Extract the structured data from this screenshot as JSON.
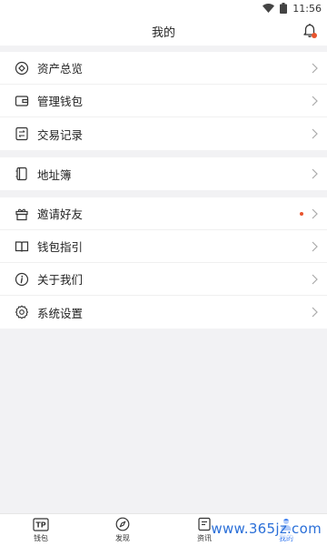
{
  "status_bar": {
    "time": "11:56"
  },
  "header": {
    "title": "我的"
  },
  "sections": [
    {
      "items": [
        {
          "label": "资产总览",
          "icon": "asset-overview-icon"
        },
        {
          "label": "管理钱包",
          "icon": "wallet-icon"
        },
        {
          "label": "交易记录",
          "icon": "transaction-record-icon"
        }
      ]
    },
    {
      "items": [
        {
          "label": "地址簿",
          "icon": "address-book-icon"
        }
      ]
    },
    {
      "items": [
        {
          "label": "邀请好友",
          "icon": "gift-icon",
          "has_badge": true
        },
        {
          "label": "钱包指引",
          "icon": "book-icon"
        },
        {
          "label": "关于我们",
          "icon": "info-icon"
        },
        {
          "label": "系统设置",
          "icon": "settings-gear-icon"
        }
      ]
    }
  ],
  "tabbar": {
    "tabs": [
      {
        "label": "钱包",
        "icon": "tp-wallet-icon",
        "tp_text": "TP"
      },
      {
        "label": "发现",
        "icon": "compass-icon"
      },
      {
        "label": "资讯",
        "icon": "news-icon"
      },
      {
        "label": "我的",
        "icon": "profile-icon",
        "active": true
      }
    ]
  },
  "watermark": "www.365jz.com",
  "colors": {
    "accent": "#3c7ef0",
    "badge": "#e8542e",
    "background": "#f2f2f4"
  }
}
